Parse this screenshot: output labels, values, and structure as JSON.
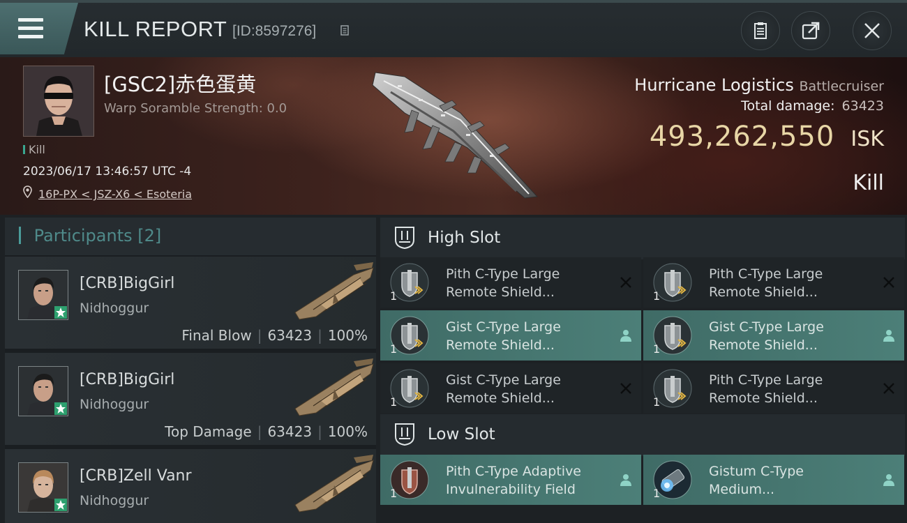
{
  "header": {
    "title": "KILL REPORT",
    "kill_id": "[ID:8597276]",
    "icons": {
      "menu": "hamburger-menu-icon",
      "copy": "copy-icon",
      "clipboard": "clipboard-icon",
      "share": "share-icon",
      "close": "close-icon"
    }
  },
  "victim": {
    "name": "[GSC2]赤色蛋黄",
    "scramble": "Warp Soramble Strength: 0.0",
    "tag": "Kill",
    "datetime": "2023/06/17 13:46:57 UTC -4",
    "location": "16P-PX < JSZ-X6 < Esoteria",
    "ship_name": "Hurricane Logistics",
    "ship_class": "Battlecruiser",
    "total_damage_label": "Total damage:",
    "total_damage": "63423",
    "isk_value": "493,262,550",
    "isk_unit": "ISK",
    "result": "Kill"
  },
  "participants": {
    "label": "Participants",
    "count": "[2]",
    "rows": [
      {
        "name": "[CRB]BigGirl",
        "ship": "Nidhoggur",
        "role": "Final Blow",
        "damage": "63423",
        "percent": "100%"
      },
      {
        "name": "[CRB]BigGirl",
        "ship": "Nidhoggur",
        "role": "Top Damage",
        "damage": "63423",
        "percent": "100%"
      },
      {
        "name": "[CRB]Zell Vanr",
        "ship": "Nidhoggur",
        "role": "",
        "damage": "",
        "percent": ""
      }
    ]
  },
  "slots": {
    "high": {
      "label": "High Slot",
      "modules": [
        {
          "qty": "1",
          "line1": "Pith C-Type Large",
          "line2": "Remote Shield...",
          "state": "destroyed"
        },
        {
          "qty": "1",
          "line1": "Pith C-Type Large",
          "line2": "Remote Shield...",
          "state": "destroyed"
        },
        {
          "qty": "1",
          "line1": "Gist C-Type Large",
          "line2": "Remote Shield...",
          "state": "dropped"
        },
        {
          "qty": "1",
          "line1": "Gist C-Type Large",
          "line2": "Remote Shield...",
          "state": "dropped"
        },
        {
          "qty": "1",
          "line1": "Gist C-Type Large",
          "line2": "Remote Shield...",
          "state": "destroyed"
        },
        {
          "qty": "1",
          "line1": "Pith C-Type Large",
          "line2": "Remote Shield...",
          "state": "destroyed"
        }
      ]
    },
    "low": {
      "label": "Low Slot",
      "modules": [
        {
          "qty": "1",
          "line1": "Pith C-Type Adaptive",
          "line2": "Invulnerability Field",
          "state": "dropped"
        },
        {
          "qty": "1",
          "line1": "Gistum C-Type",
          "line2": "Medium...",
          "state": "dropped"
        }
      ]
    }
  },
  "colors": {
    "accent_teal": "#4c7f78",
    "isk_gold": "#e8d6a6",
    "star_green": "#2ea06f"
  }
}
